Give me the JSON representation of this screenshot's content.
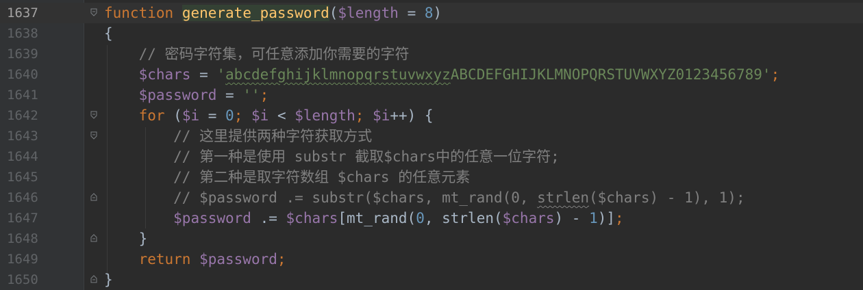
{
  "editor": {
    "line_numbers": [
      "1637",
      "1638",
      "1639",
      "1640",
      "1641",
      "1642",
      "1643",
      "1644",
      "1645",
      "1646",
      "1647",
      "1648",
      "1649",
      "1650"
    ],
    "l1637": {
      "t1": "function",
      "t2": " ",
      "t3": "generate_password",
      "t4": "(",
      "t5": "$length",
      "t6": " = ",
      "t7": "8",
      "t8": ")"
    },
    "l1638": {
      "t1": "{"
    },
    "l1639": {
      "t1": "    // 密码字符集，可任意添加你需要的字符"
    },
    "l1640": {
      "t1": "    ",
      "t2": "$chars",
      "t3": " = ",
      "t4": "'",
      "t5": "abcdefghijklmnopqrstuvwxyz",
      "t6": "ABCDEFGHIJKLMNOPQRSTUVWXYZ0123456789'",
      "t7": ";"
    },
    "l1641": {
      "t1": "    ",
      "t2": "$password",
      "t3": " = ",
      "t4": "''",
      "t5": ";"
    },
    "l1642": {
      "t1": "    ",
      "t2": "for",
      "t3": " (",
      "t4": "$i",
      "t5": " = ",
      "t6": "0",
      "t7": "; ",
      "t8": "$i",
      "t9": " < ",
      "t10": "$length",
      "t11": "; ",
      "t12": "$i",
      "t13": "++) {"
    },
    "l1643": {
      "t1": "        // 这里提供两种字符获取方式"
    },
    "l1644": {
      "t1": "        // 第一种是使用 substr 截取$chars中的任意一位字符;"
    },
    "l1645": {
      "t1": "        // 第二种是取字符数组 $chars 的任意元素"
    },
    "l1646": {
      "t1": "        // $password .= substr($chars, mt_rand(0, ",
      "t2": "strlen",
      "t3": "($chars) - 1), 1);"
    },
    "l1647": {
      "t1": "        ",
      "t2": "$password",
      "t3": " .= ",
      "t4": "$chars",
      "t5": "[mt_rand(",
      "t6": "0",
      "t7": ", strlen(",
      "t8": "$chars",
      "t9": ") - ",
      "t10": "1",
      "t11": ")]",
      "t12": ";"
    },
    "l1648": {
      "t1": "    }"
    },
    "l1649": {
      "t1": "    ",
      "t2": "return",
      "t3": " ",
      "t4": "$password",
      "t5": ";"
    },
    "l1650": {
      "t1": "}"
    }
  },
  "colors": {
    "background": "#2b2b2b",
    "gutter": "#313335",
    "keyword": "#cc7832",
    "function": "#ffc66d",
    "variable": "#9876aa",
    "number": "#6897bb",
    "string": "#6a8759",
    "comment": "#808080",
    "plain": "#a9b7c6"
  },
  "icons": {
    "fold_open": "fold-open-icon",
    "fold_end": "fold-end-icon"
  }
}
